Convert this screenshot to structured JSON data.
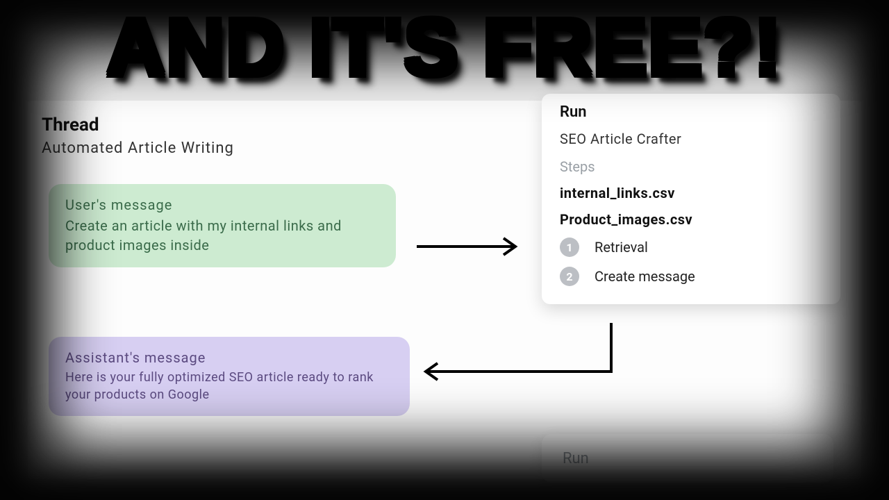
{
  "headline": "AND IT'S FREE?!",
  "thread": {
    "title": "Thread",
    "subtitle": "Automated Article Writing"
  },
  "messages": {
    "user": {
      "label": "User's message",
      "body": "Create an article with my internal links and product images inside"
    },
    "assistant": {
      "label": "Assistant's message",
      "body": "Here is your fully optimized SEO article ready to rank your products on Google"
    }
  },
  "run": {
    "title": "Run",
    "crafter": "SEO Article Crafter",
    "steps_label": "Steps",
    "files": [
      "internal_links.csv",
      "Product_images.csv"
    ],
    "steps": [
      {
        "num": "1",
        "label": "Retrieval"
      },
      {
        "num": "2",
        "label": "Create message"
      }
    ],
    "button": "Run"
  }
}
